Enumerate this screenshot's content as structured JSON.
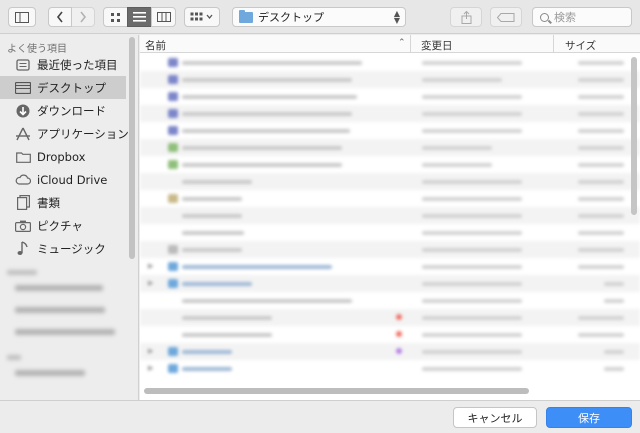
{
  "path_popup": {
    "label": "デスクトップ",
    "icon": "folder-icon"
  },
  "search": {
    "placeholder": "検索"
  },
  "toolbar_icons": [
    "sidebar-toggle-icon",
    "back-icon",
    "forward-icon",
    "icon-view-icon",
    "list-view-icon",
    "column-view-icon",
    "arrange-icon",
    "share-icon",
    "tag-icon"
  ],
  "sidebar": {
    "favorites_header": "よく使う項目",
    "items": [
      {
        "label": "最近使った項目",
        "icon": "recent-icon"
      },
      {
        "label": "デスクトップ",
        "icon": "desktop-icon",
        "selected": true
      },
      {
        "label": "ダウンロード",
        "icon": "download-icon"
      },
      {
        "label": "アプリケーション",
        "icon": "applications-icon"
      },
      {
        "label": "Dropbox",
        "icon": "folder-icon"
      },
      {
        "label": "iCloud Drive",
        "icon": "cloud-icon"
      },
      {
        "label": "書類",
        "icon": "documents-icon"
      },
      {
        "label": "ピクチャ",
        "icon": "camera-icon"
      },
      {
        "label": "ミュージック",
        "icon": "music-icon"
      }
    ]
  },
  "columns": {
    "name": "名前",
    "date": "変更日",
    "size": "サイズ"
  },
  "buttons": {
    "cancel": "キャンセル",
    "save": "保存"
  },
  "colors": {
    "accent": "#3d8ef7",
    "folder": "#6fa8dc",
    "selection": "#cdcdcd"
  }
}
